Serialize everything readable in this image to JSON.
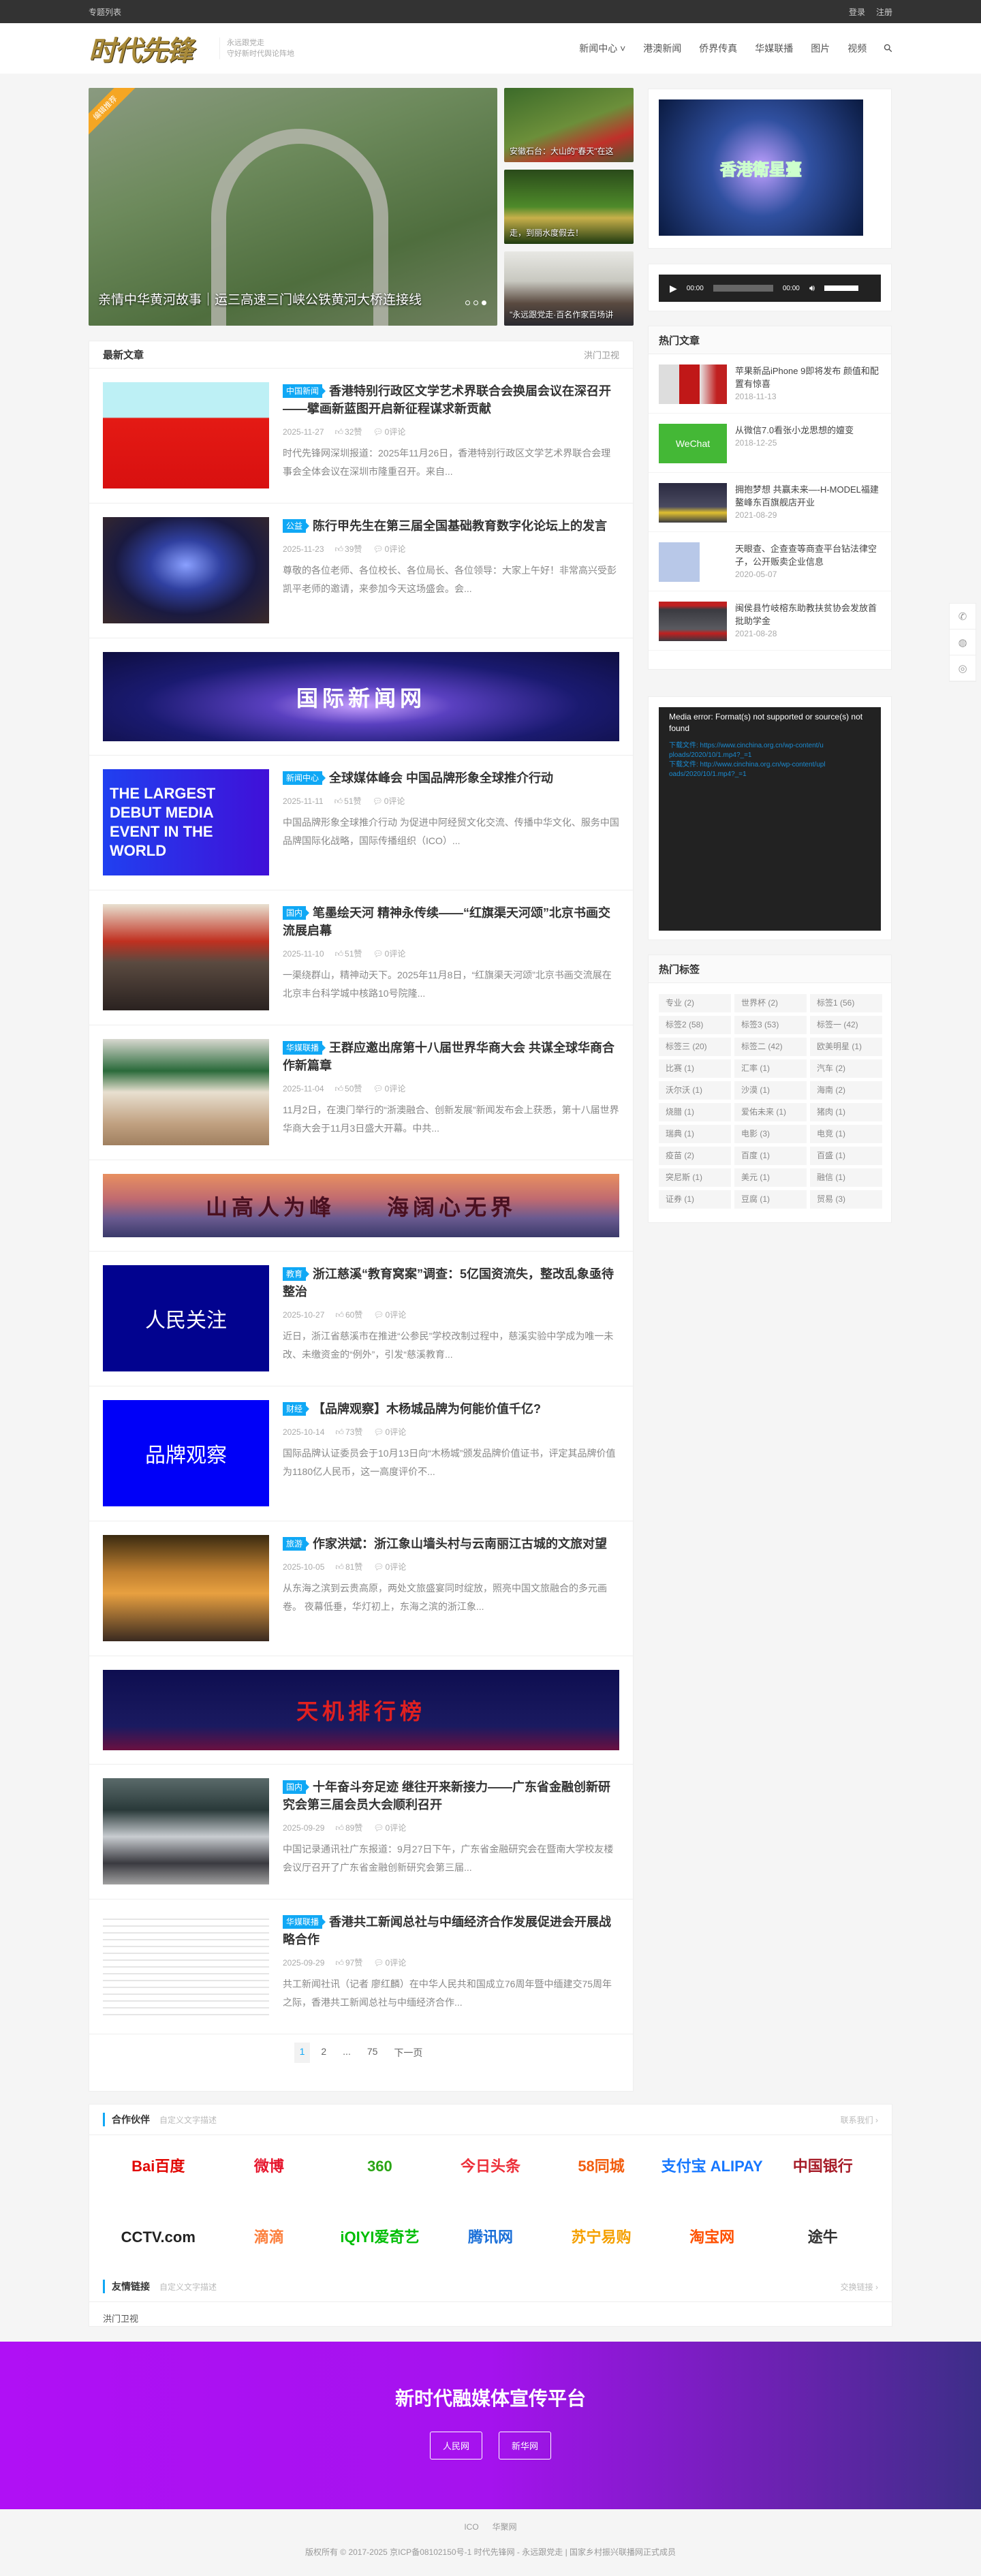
{
  "topbar": {
    "left": "专题列表",
    "login": "登录",
    "register": "注册"
  },
  "header": {
    "logo": "时代先锋",
    "tagline1": "永远跟党走",
    "tagline2": "守好新时代舆论阵地",
    "nav": [
      "新闻中心 ˅",
      "港澳新闻",
      "侨界传真",
      "华媒联播",
      "图片",
      "视频"
    ]
  },
  "slider": {
    "ribbon": "编辑推荐",
    "main_caption": "亲情中华黄河故事｜运三高速三门峡公铁黄河大桥连接线",
    "side": [
      {
        "caption": "安徽石台：大山的\"春天\"在这",
        "bg": "linear-gradient(160deg,#3c6b2a,#6c8f3a 50%,#c0302a 75%,#4a5a30)"
      },
      {
        "caption": "走，到丽水度假去！",
        "bg": "linear-gradient(180deg,#2a4a1a,#4e8a2a 50%,#c8b04a 65%,#1e3a10)"
      },
      {
        "caption": "\"永远跟党走·百名作家百场讲",
        "bg": "linear-gradient(180deg,#e8e8e4,#c8c8c0 40%,#5a4a40 70%,#2a2a30)"
      }
    ]
  },
  "latest": {
    "title": "最新文章",
    "more": "洪门卫视",
    "items": [
      {
        "type": "article",
        "tag": "中国新闻",
        "title": "香港特别行政区文学艺术界联合会换届会议在深召开——擘画新蓝图开启新征程谋求新贡献",
        "date": "2025-11-27",
        "likes": "32赞",
        "comments": "0评论",
        "excerpt": "时代先锋网深圳报道：2025年11月26日，香港特别行政区文学艺术界联合会理事会全体会议在深圳市隆重召开。来自...",
        "bg": "linear-gradient(180deg,#bdf0f5 0%,#bdf0f5 33%,#e41a14 34%,#d81010 100%)",
        "thumb_text": ""
      },
      {
        "type": "article",
        "tag": "公益",
        "title": "陈行甲先生在第三届全国基础教育数字化论坛上的发言",
        "date": "2025-11-23",
        "likes": "39赞",
        "comments": "0评论",
        "excerpt": "尊敬的各位老师、各位校长、各位局长、各位领导：大家上午好！非常高兴受彭凯平老师的邀请，来参加今天这场盛会。会...",
        "bg": "radial-gradient(ellipse at 50% 45%,#8aa0ff 0%,#3040a0 30%,#1a1a40 60%,#3a2a2a 100%)",
        "thumb_text": ""
      },
      {
        "type": "banner",
        "bg": "radial-gradient(ellipse at 50% 60%,#c8a0ff 0%,#5a40c0 25%,#1a1a70 60%,#0e0e40 100%)",
        "text": "国际新闻网",
        "color": "#ffffff"
      },
      {
        "type": "article",
        "tag": "新闻中心",
        "title": "全球媒体峰会 中国品牌形象全球推介行动",
        "date": "2025-11-11",
        "likes": "51赞",
        "comments": "0评论",
        "excerpt": "中国品牌形象全球推介行动 为促进中阿经贸文化交流、传播中华文化、服务中国品牌国际化战略，国际传播组织（ICO）...",
        "bg": "linear-gradient(90deg,#2040f0,#4010d8)",
        "thumb_text": "THE LARGEST DEBUT MEDIA EVENT IN THE WORLD"
      },
      {
        "type": "article",
        "tag": "国内",
        "title": "笔墨绘天河 精神永传续——“红旗渠天河颂”北京书画交流展启幕",
        "date": "2025-11-10",
        "likes": "51赞",
        "comments": "0评论",
        "excerpt": "一渠绕群山，精神动天下。2025年11月8日，“红旗渠天河颂”北京书画交流展在北京丰台科学城中核路10号院隆...",
        "bg": "linear-gradient(180deg,#e8e0d0 0%,#c03020 35%,#5a4a40 55%,#2a2220 100%)",
        "thumb_text": ""
      },
      {
        "type": "article",
        "tag": "华媒联播",
        "title": "王群应邀出席第十八届世界华商大会 共谋全球华商合作新篇章",
        "date": "2025-11-04",
        "likes": "50赞",
        "comments": "0评论",
        "excerpt": "11月2日，在澳门举行的“浙澳融合、创新发展”新闻发布会上获悉，第十八届世界华商大会于11月3日盛大开幕。中共...",
        "bg": "linear-gradient(180deg,#d8d8d0 0%,#2a6a3a 30%,#e8e0d0 50%,#c0a080 80%,#a08060 100%)",
        "thumb_text": ""
      },
      {
        "type": "banner",
        "bg": "linear-gradient(180deg,#e89060 0%,#c06a70 40%,#6a5a90 70%,#3a3a6a 100%)",
        "text": "山高人为峰　　海阔心无界",
        "color": "#4a1020"
      },
      {
        "type": "article",
        "tag": "教育",
        "title": "浙江慈溪“教育窝案”调查：5亿国资流失，整改乱象亟待整治",
        "date": "2025-10-27",
        "likes": "60赞",
        "comments": "0评论",
        "excerpt": "近日，浙江省慈溪市在推进“公参民”学校改制过程中，慈溪实验中学成为唯一未改、未缴资金的“例外”，引发“慈溪教育...",
        "bg": "#02038f",
        "thumb_text": "人民关注"
      },
      {
        "type": "article",
        "tag": "财经",
        "title": "【品牌观察】木杨城品牌为何能价值千亿?",
        "date": "2025-10-14",
        "likes": "73赞",
        "comments": "0评论",
        "excerpt": "国际品牌认证委员会于10月13日向“木杨城”颁发品牌价值证书，评定其品牌价值为1180亿人民币，这一高度评价不...",
        "bg": "#0000f8",
        "thumb_text": "品牌观察"
      },
      {
        "type": "article",
        "tag": "旅游",
        "title": "作家洪斌：浙江象山墙头村与云南丽江古城的文旅对望",
        "date": "2025-10-05",
        "likes": "81赞",
        "comments": "0评论",
        "excerpt": "从东海之滨到云贵高原，两处文旅盛宴同时绽放，照亮中国文旅融合的多元画卷。 夜幕低垂，华灯初上，东海之滨的浙江象...",
        "bg": "linear-gradient(180deg,#3a2a10 0%,#c08030 35%,#e8a040 55%,#3a2a20 100%)",
        "thumb_text": ""
      },
      {
        "type": "banner",
        "bg": "linear-gradient(180deg,#0e0e50 0%,#1a1a60 70%,#6a1040 100%)",
        "text": "天机排行榜",
        "color": "#e02020"
      },
      {
        "type": "article",
        "tag": "国内",
        "title": "十年奋斗夯足迹 继往开来新接力——广东省金融创新研究会第三届会员大会顺利召开",
        "date": "2025-09-29",
        "likes": "89赞",
        "comments": "0评论",
        "excerpt": "中国记录通讯社广东报道：9月27日下午，广东省金融研究会在暨南大学校友楼会议厅召开了广东省金融创新研究会第三届...",
        "bg": "linear-gradient(180deg,#5a6a6a 0%,#2a3a3a 30%,#c8ccd0 55%,#3a3a40 80%,#a0a0a0 100%)",
        "thumb_text": ""
      },
      {
        "type": "article",
        "tag": "华媒联播",
        "title": "香港共工新闻总社与中缅经济合作发展促进会开展战略合作",
        "date": "2025-09-29",
        "likes": "97赞",
        "comments": "0评论",
        "excerpt": "共工新闻社讯（记者 廖红麟）在中华人民共和国成立76周年暨中缅建交75周年之际，香港共工新闻总社与中缅经济合作...",
        "bg": "repeating-linear-gradient(180deg,#fff 0,#fff 8px,#ccc 9px,#fff 10px)",
        "thumb_text": ""
      }
    ]
  },
  "pagination": [
    "1",
    "2",
    "...",
    "75",
    "下一页"
  ],
  "sidebar": {
    "video_title": "香港衛星臺",
    "audio": {
      "current": "00:00",
      "duration": "00:00"
    },
    "hot_title": "热门文章",
    "hot": [
      {
        "title": "苹果新品iPhone 9即将发布 颜值和配置有惊喜",
        "date": "2018-11-13",
        "bg": "linear-gradient(90deg,#ddd 30%,#c01818 30%,#c01818 60%,#e8e8e8 60%,#c02020 85%)"
      },
      {
        "title": "从微信7.0看张小龙思想的嬗变",
        "date": "2018-12-25",
        "bg": "#44b836",
        "text": "WeChat"
      },
      {
        "title": "拥抱梦想 共赢未来—-H-MODEL福建鳌峰东百旗舰店开业",
        "date": "2021-08-29",
        "bg": "linear-gradient(180deg,#2a2a40,#4a4a60 60%,#e0c030 75%,#3a3a40)"
      },
      {
        "title": "天眼查、企查查等商查平台钻法律空子，公开贩卖企业信息",
        "date": "2020-05-07",
        "bg": "linear-gradient(90deg,#b8c8e8 60%,#fff 60%)"
      },
      {
        "title": "闽侯县竹岐榕东助教扶贫协会发放首批助学金",
        "date": "2021-08-28",
        "bg": "linear-gradient(180deg,#c02020 10%,#3a3a40 20%,#5a5a60 70%,#c02020 80%,#3a3a40)"
      }
    ],
    "media_error": "Media error: Format(s) not supported or source(s) not found",
    "media_links": [
      "下载文件: https://www.cinchina.org.cn/wp-content/uploads/2020/10/1.mp4?_=1",
      "下载文件: http://www.cinchina.org.cn/wp-content/uploads/2020/10/1.mp4?_=1"
    ],
    "tags_title": "热门标签",
    "tags": [
      "专业 (2)",
      "世界杯 (2)",
      "标签1 (56)",
      "标签2 (58)",
      "标签3 (53)",
      "标签一 (42)",
      "标签三 (20)",
      "标签二 (42)",
      "欧美明星 (1)",
      "比赛 (1)",
      "汇率 (1)",
      "汽车 (2)",
      "沃尔沃 (1)",
      "沙漠 (1)",
      "海南 (2)",
      "烧腊 (1)",
      "爱佑未来 (1)",
      "猪肉 (1)",
      "瑞典 (1)",
      "电影 (3)",
      "电竞 (1)",
      "疫苗 (2)",
      "百度 (1)",
      "百盛 (1)",
      "突尼斯 (1)",
      "美元 (1)",
      "融信 (1)",
      "证券 (1)",
      "豆腐 (1)",
      "贸易 (3)"
    ]
  },
  "partners": {
    "title": "合作伙伴",
    "desc": "自定义文字描述",
    "more": "联系我们 ›",
    "logos": [
      {
        "name": "Bai百度",
        "color": "#e10602"
      },
      {
        "name": "微博",
        "color": "#e6162d"
      },
      {
        "name": "360",
        "color": "#2aa515"
      },
      {
        "name": "今日头条",
        "color": "#ed2f3a"
      },
      {
        "name": "58同城",
        "color": "#f25d0e"
      },
      {
        "name": "支付宝 ALIPAY",
        "color": "#1677ff"
      },
      {
        "name": "中国银行",
        "color": "#a61c28"
      },
      {
        "name": "CCTV.com",
        "color": "#222222"
      },
      {
        "name": "滴滴",
        "color": "#fc7e3b"
      },
      {
        "name": "iQIYI爱奇艺",
        "color": "#00be06"
      },
      {
        "name": "腾讯网",
        "color": "#1a6fd8"
      },
      {
        "name": "苏宁易购",
        "color": "#f5a000"
      },
      {
        "name": "淘宝网",
        "color": "#ff5000"
      },
      {
        "name": "途牛",
        "color": "#333333"
      }
    ]
  },
  "links": {
    "title": "友情链接",
    "desc": "自定义文字描述",
    "more": "交换链接 ›",
    "items": [
      "洪门卫视"
    ]
  },
  "cta": {
    "title": "新时代融媒体宣传平台",
    "buttons": [
      "人民网",
      "新华网"
    ]
  },
  "footer": {
    "links": [
      "ICO",
      "华聚网"
    ],
    "copyright": "版权所有 © 2017-2025 京ICP备08102150号-1 时代先锋网 - 永远跟党走 | 国家乡村振兴联播网正式成员"
  },
  "float": [
    "phone-icon",
    "wechat-icon",
    "weibo-icon"
  ]
}
